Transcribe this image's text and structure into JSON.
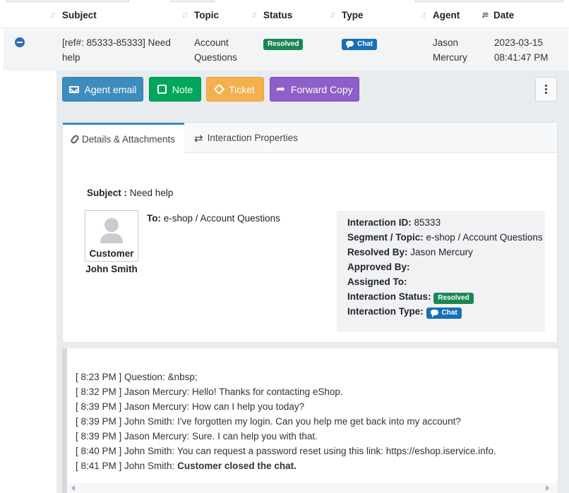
{
  "table": {
    "headers": {
      "subject": "Subject",
      "topic": "Topic",
      "status": "Status",
      "type": "Type",
      "agent": "Agent",
      "date": "Date"
    },
    "row": {
      "subject": "[ref#: 85333-85333] Need help",
      "topic": "Account Questions",
      "status": "Resolved",
      "type": "Chat",
      "agent": "Jason Mercury",
      "date_line1": "2023-03-15",
      "date_line2": "08:41:47 PM"
    }
  },
  "actions": {
    "agent_email": "Agent email",
    "note": "Note",
    "ticket": "Ticket",
    "forward_copy": "Forward Copy"
  },
  "tabs": {
    "details": "Details & Attachments",
    "properties": "Interaction Properties"
  },
  "details": {
    "subject_label": "Subject :",
    "subject_value": "Need help",
    "customer_role": "Customer",
    "customer_name": "John Smith",
    "to_label": "To:",
    "to_value": "e-shop / Account Questions"
  },
  "properties": {
    "interaction_id_label": "Interaction ID:",
    "interaction_id_value": "85333",
    "segment_label": "Segment / Topic:",
    "segment_value": "e-shop / Account Questions",
    "resolved_by_label": "Resolved By:",
    "resolved_by_value": "Jason Mercury",
    "approved_by_label": "Approved By:",
    "assigned_to_label": "Assigned To:",
    "status_label": "Interaction Status:",
    "status_value": "Resolved",
    "type_label": "Interaction Type:",
    "type_value": "Chat"
  },
  "transcript": [
    {
      "text": "[ 8:23 PM ] Question: &nbsp;"
    },
    {
      "text": "[ 8:32 PM ] Jason Mercury: Hello! Thanks for contacting eShop."
    },
    {
      "text": "[ 8:39 PM ] Jason Mercury: How can I help you today?"
    },
    {
      "text": "[ 8:39 PM ] John Smith: I've forgotten my login. Can you help me get back into my account?"
    },
    {
      "text": "[ 8:39 PM ] Jason Mercury: Sure. I can help you with that."
    },
    {
      "text": "[ 8:40 PM ] John Smith: You can request a password reset using this link: https://eshop.iservice.info."
    },
    {
      "prefix": "[ 8:41 PM ] John Smith: ",
      "bold": "Customer closed the chat."
    }
  ],
  "colors": {
    "accent": "#3c8dbc",
    "resolved": "#198754",
    "chat": "#1670b8",
    "note": "#00a65a",
    "ticket": "#f5b04e",
    "forward": "#8e5fc8"
  }
}
